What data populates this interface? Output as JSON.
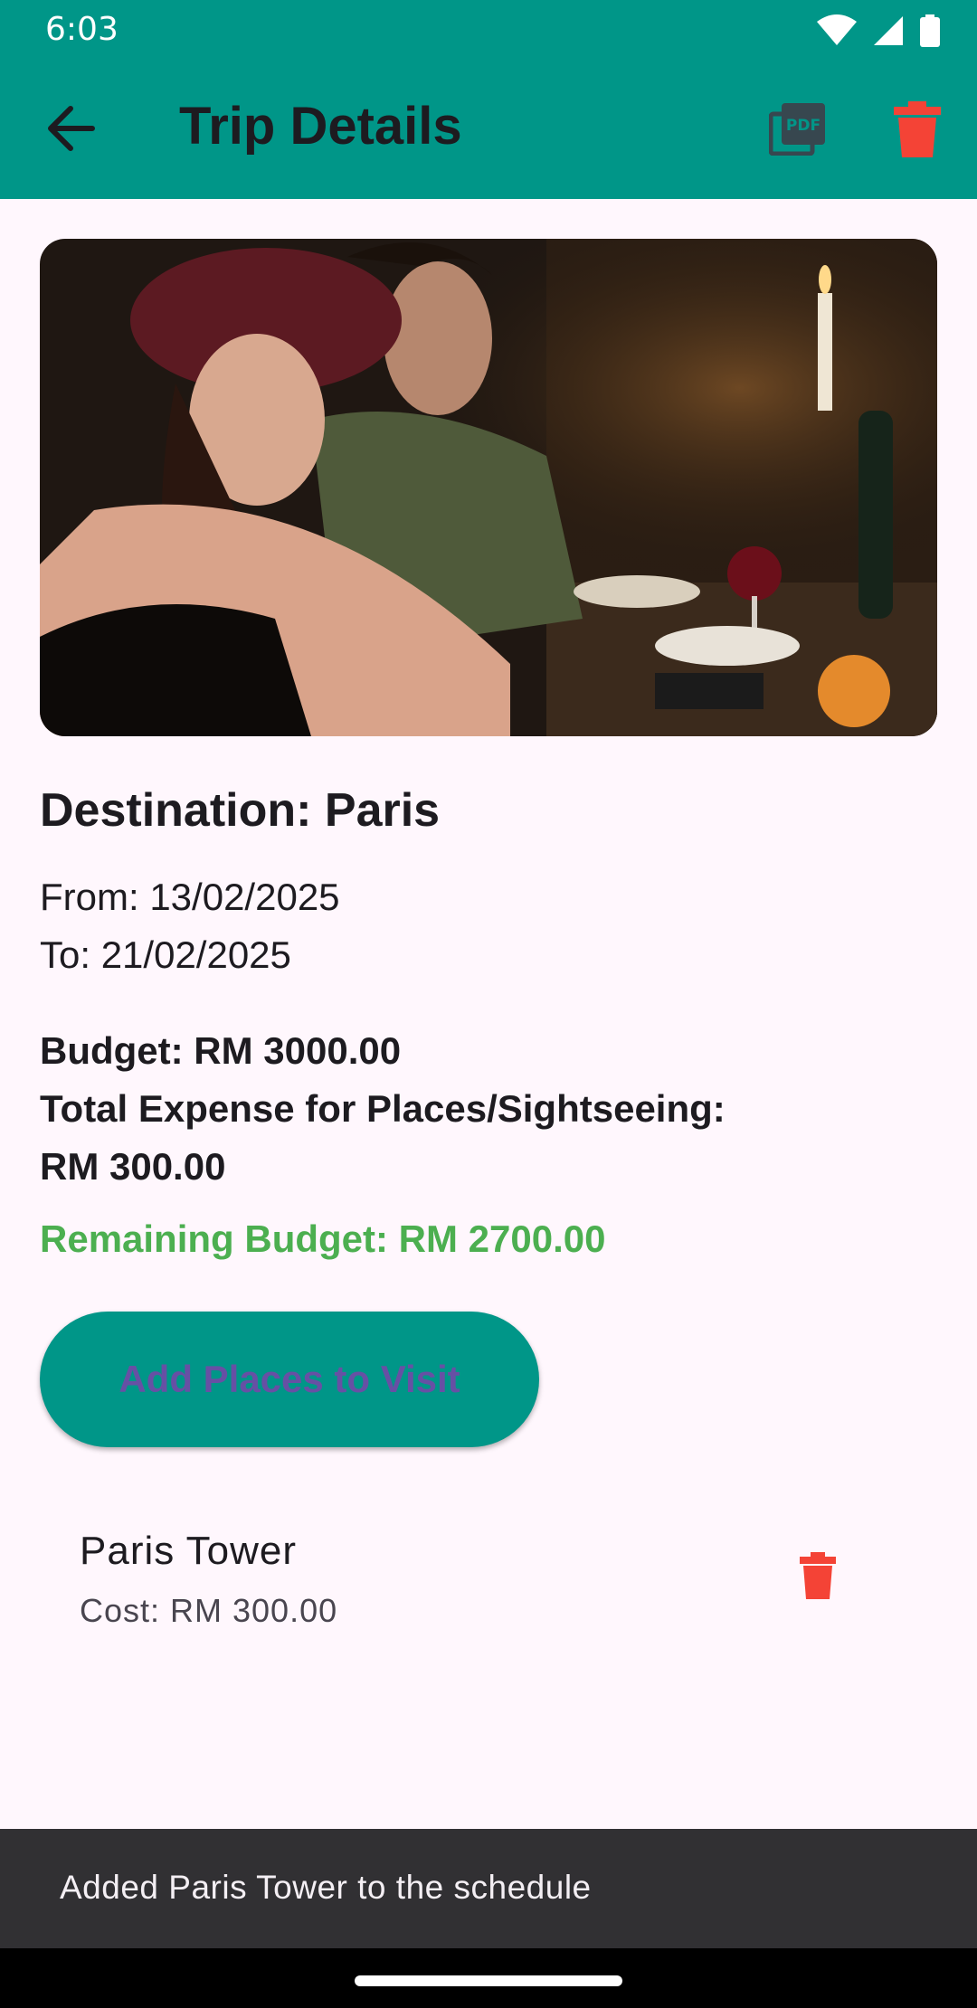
{
  "status_bar": {
    "time": "6:03"
  },
  "toolbar": {
    "title": "Trip Details"
  },
  "trip": {
    "destination": "Destination: Paris",
    "from": "From: 13/02/2025",
    "to": "To: 21/02/2025",
    "budget": "Budget: RM 3000.00",
    "total_expense_label": "Total Expense for Places/Sightseeing:",
    "total_expense_value": "RM 300.00",
    "remaining": "Remaining Budget: RM 2700.00"
  },
  "add_button": {
    "label": "Add Places to Visit"
  },
  "places": [
    {
      "name": "Paris Tower",
      "cost": "Cost: RM 300.00"
    }
  ],
  "snackbar": {
    "message": "Added Paris Tower to the schedule"
  },
  "colors": {
    "primary": "#009688",
    "delete": "#f44336",
    "remaining": "#4caf50",
    "button_text": "#6750a4"
  },
  "icons": [
    "arrow-back-icon",
    "pdf-icon",
    "delete-icon",
    "wifi-icon",
    "signal-icon",
    "battery-icon"
  ]
}
